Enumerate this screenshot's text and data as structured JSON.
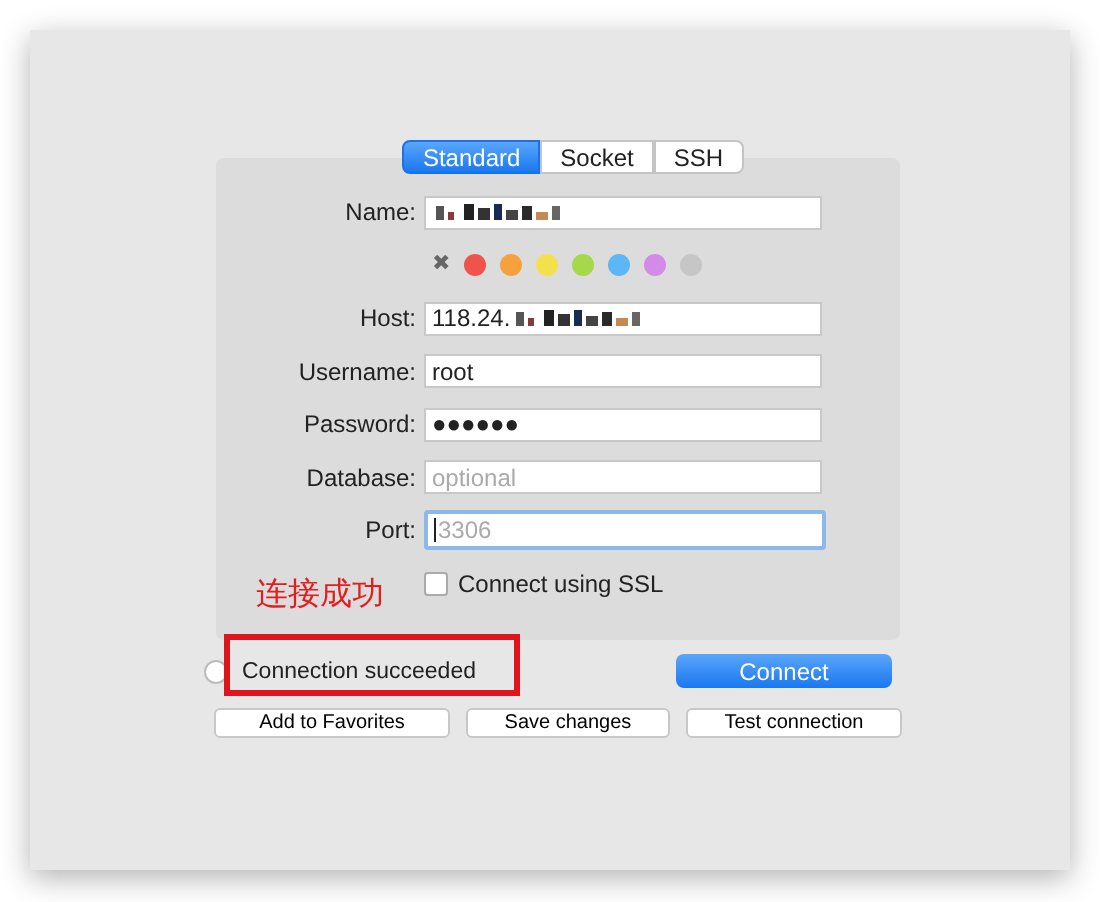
{
  "tabs": [
    {
      "label": "Standard",
      "selected": true
    },
    {
      "label": "Socket",
      "selected": false
    },
    {
      "label": "SSH",
      "selected": false
    }
  ],
  "fields": [
    {
      "kind": "text",
      "label": "Name:",
      "redacted": true
    },
    {
      "kind": "colors",
      "clear": "✖",
      "colors": [
        {
          "color": "#f0524c"
        },
        {
          "color": "#f7a13c"
        },
        {
          "color": "#f4e04d"
        },
        {
          "color": "#a6d84a"
        },
        {
          "color": "#5db7f5"
        },
        {
          "color": "#d48ae8"
        },
        {
          "color": "#c6c6c6"
        }
      ]
    },
    {
      "kind": "text",
      "label": "Host:",
      "value": "118.24.",
      "redacted": true
    },
    {
      "kind": "text",
      "label": "Username:",
      "value": "root"
    },
    {
      "kind": "text",
      "label": "Password:",
      "value": "●●●●●●"
    },
    {
      "kind": "text",
      "label": "Database:",
      "placeholder": "optional"
    },
    {
      "kind": "text",
      "label": "Port:",
      "placeholder": "3306",
      "focused": true
    },
    {
      "kind": "checkbox",
      "label": "Connect using SSL",
      "checked": false
    }
  ],
  "annotation": "连接成功",
  "status": "Connection succeeded",
  "connect_button": "Connect",
  "buttons": [
    "Add to Favorites",
    "Save changes",
    "Test connection"
  ]
}
